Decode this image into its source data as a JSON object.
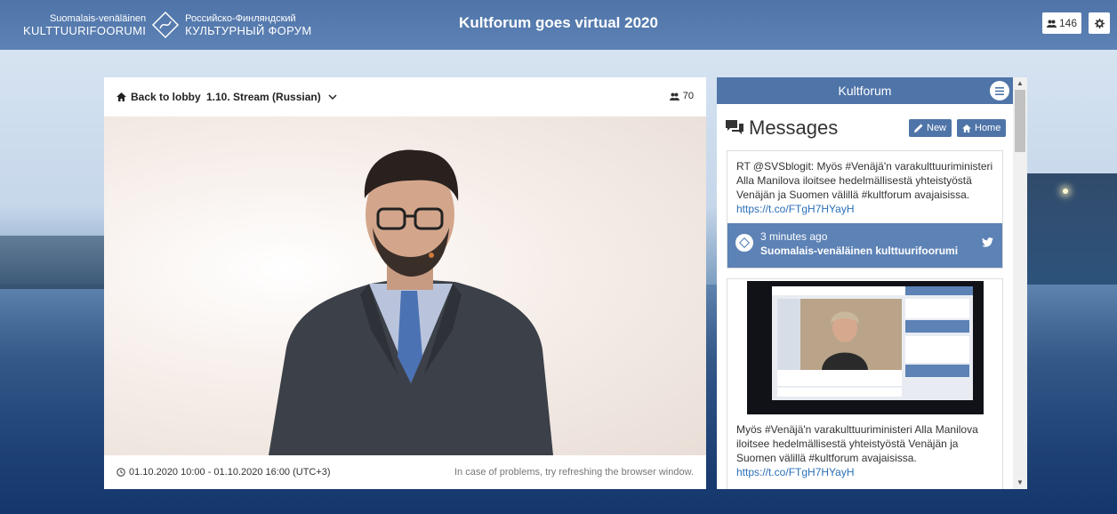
{
  "header": {
    "logo_fi_line1": "Suomalais-venäläinen",
    "logo_fi_line2": "KULTTUURIFOORUMI",
    "logo_ru_line1": "Российско-Финляндский",
    "logo_ru_line2": "КУЛЬТУРНЫЙ ФОРУМ",
    "title": "Kultforum goes virtual 2020",
    "viewer_count": "146"
  },
  "video": {
    "back_label": "Back to lobby",
    "stream_label": "1.10. Stream (Russian)",
    "viewer_count": "70",
    "dates": "01.10.2020 10:00 - 01.10.2020 16:00 (UTC+3)",
    "problems_text": "In case of problems, try refreshing the browser window."
  },
  "chat": {
    "header_title": "Kultforum",
    "messages_title": "Messages",
    "new_label": "New",
    "home_label": "Home",
    "message1": {
      "text": "RT @SVSblogit: Myös #Venäjä'n varakulttuuriministeri Alla Manilova iloitsee hedelmällisestä yhteistyöstä Venäjän ja Suomen välillä #kultforum avajaisissa.",
      "link": "https://t.co/FTgH7HYayH",
      "time_ago": "3 minutes ago",
      "author": "Suomalais-venäläinen kulttuurifoorumi"
    },
    "message2": {
      "text": "Myös #Venäjä'n varakulttuuriministeri Alla Manilova iloitsee hedelmällisestä yhteistyöstä Venäjän ja Suomen välillä #kultforum avajaisissa.",
      "link": "https://t.co/FTgH7HYayH"
    }
  },
  "colors": {
    "accent": "#4f74a8",
    "accent_light": "#5d82b5",
    "link": "#2a6fb8"
  }
}
